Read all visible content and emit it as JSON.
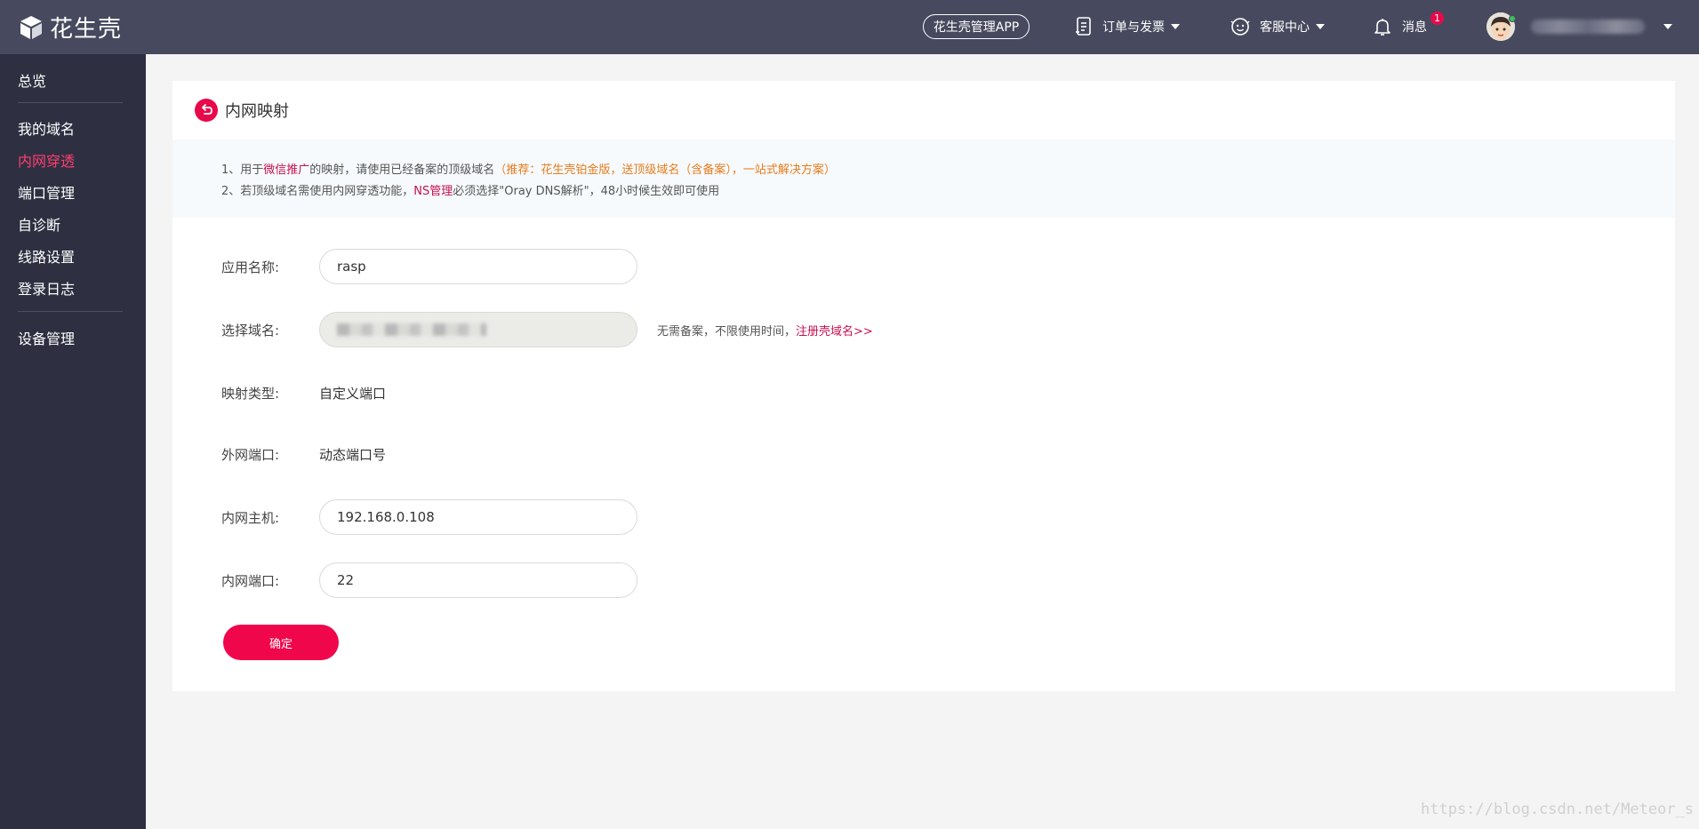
{
  "header": {
    "logo_text": "花生壳",
    "app_button": "花生壳管理APP",
    "nav": {
      "orders": "订单与发票",
      "service": "客服中心",
      "messages": "消息",
      "messages_badge": "1"
    }
  },
  "sidebar": {
    "items": [
      {
        "label": "总览"
      },
      {
        "label": "我的域名"
      },
      {
        "label": "内网穿透"
      },
      {
        "label": "端口管理"
      },
      {
        "label": "自诊断"
      },
      {
        "label": "线路设置"
      },
      {
        "label": "登录日志"
      },
      {
        "label": "设备管理"
      }
    ],
    "active": "内网穿透"
  },
  "card": {
    "title": "内网映射",
    "notice": {
      "line1_prefix": "1、用于",
      "line1_hl": "微信推广",
      "line1_mid": "的映射，请使用已经备案的顶级域名",
      "line1_orange": "（推荐：花生壳铂金版，送顶级域名（含备案），一站式解决方案）",
      "line2_prefix": "2、若顶级域名需使用内网穿透功能，",
      "line2_hl": "NS管理",
      "line2_suffix": "必须选择\"Oray DNS解析\"，48小时候生效即可使用"
    },
    "form": {
      "app_name_label": "应用名称:",
      "app_name_value": "rasp",
      "domain_label": "选择域名:",
      "domain_hint": "无需备案，不限使用时间，",
      "domain_hint_link": "注册壳域名>>",
      "mapping_type_label": "映射类型:",
      "mapping_type_value": "自定义端口",
      "external_port_label": "外网端口:",
      "external_port_value": "动态端口号",
      "host_label": "内网主机:",
      "host_value": "192.168.0.108",
      "port_label": "内网端口:",
      "port_value": "22",
      "submit_label": "确定"
    }
  },
  "watermark": "https://blog.csdn.net/Meteor_s",
  "colors": {
    "topbar": "#474a5e",
    "sidebar": "#2e3041",
    "accent": "#e8094b",
    "active_nav": "#ff3e6f"
  }
}
